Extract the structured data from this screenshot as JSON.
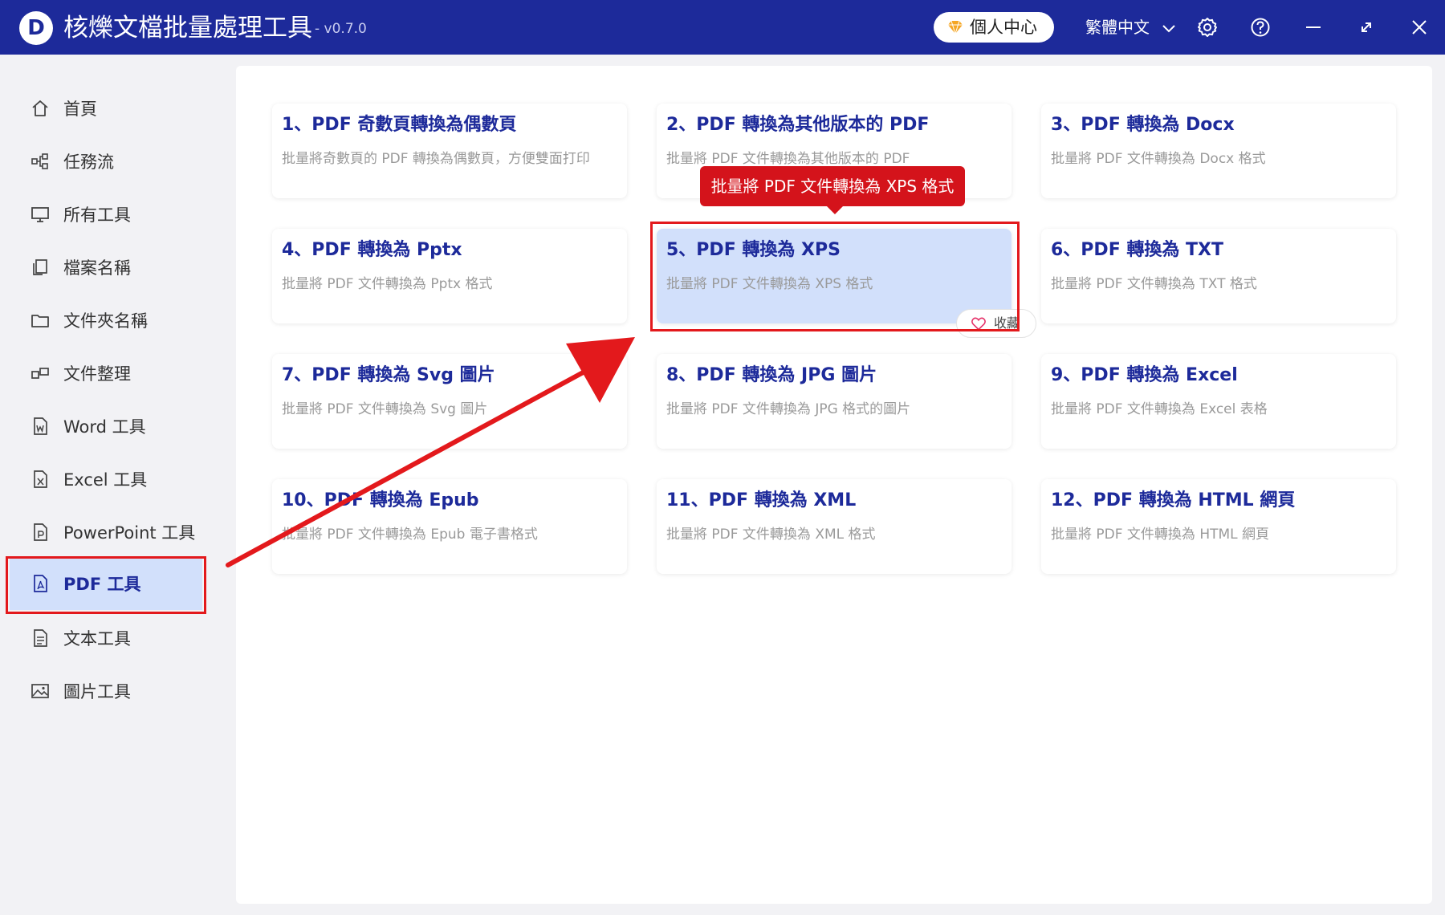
{
  "titlebar": {
    "app_title": "核爍文檔批量處理工具",
    "version": "- v0.7.0",
    "user_center_label": "個人中心",
    "language": "繁體中文",
    "icons": [
      "settings-icon",
      "help-icon",
      "minimize-icon",
      "maximize-icon",
      "close-icon"
    ]
  },
  "sidebar": {
    "items": [
      {
        "label": "首頁",
        "icon": "home-icon"
      },
      {
        "label": "任務流",
        "icon": "workflow-icon"
      },
      {
        "label": "所有工具",
        "icon": "monitor-icon"
      },
      {
        "label": "檔案名稱",
        "icon": "file-copy-icon"
      },
      {
        "label": "文件夾名稱",
        "icon": "folder-icon"
      },
      {
        "label": "文件整理",
        "icon": "organize-icon"
      },
      {
        "label": "Word 工具",
        "icon": "word-doc-icon"
      },
      {
        "label": "Excel 工具",
        "icon": "excel-doc-icon"
      },
      {
        "label": "PowerPoint 工具",
        "icon": "ppt-doc-icon"
      },
      {
        "label": "PDF 工具",
        "icon": "pdf-doc-icon",
        "active": true
      },
      {
        "label": "文本工具",
        "icon": "text-doc-icon"
      },
      {
        "label": "圖片工具",
        "icon": "image-icon"
      }
    ]
  },
  "tools": [
    {
      "title": "1、PDF 奇數頁轉換為偶數頁",
      "desc": "批量將奇數頁的 PDF 轉換為偶數頁，方便雙面打印"
    },
    {
      "title": "2、PDF 轉換為其他版本的 PDF",
      "desc": "批量將 PDF 文件轉換為其他版本的 PDF"
    },
    {
      "title": "3、PDF 轉換為 Docx",
      "desc": "批量將 PDF 文件轉換為 Docx 格式"
    },
    {
      "title": "4、PDF 轉換為 Pptx",
      "desc": "批量將 PDF 文件轉換為 Pptx 格式"
    },
    {
      "title": "5、PDF 轉換為 XPS",
      "desc": "批量將 PDF 文件轉換為 XPS 格式",
      "hovered": true
    },
    {
      "title": "6、PDF 轉換為 TXT",
      "desc": "批量將 PDF 文件轉換為 TXT 格式"
    },
    {
      "title": "7、PDF 轉換為 Svg 圖片",
      "desc": "批量將 PDF 文件轉換為 Svg 圖片"
    },
    {
      "title": "8、PDF 轉換為 JPG 圖片",
      "desc": "批量將 PDF 文件轉換為 JPG 格式的圖片"
    },
    {
      "title": "9、PDF 轉換為 Excel",
      "desc": "批量將 PDF 文件轉換為 Excel 表格"
    },
    {
      "title": "10、PDF 轉換為 Epub",
      "desc": "批量將 PDF 文件轉換為 Epub 電子書格式"
    },
    {
      "title": "11、PDF 轉換為 XML",
      "desc": "批量將 PDF 文件轉換為 XML 格式"
    },
    {
      "title": "12、PDF 轉換為 HTML 網頁",
      "desc": "批量將 PDF 文件轉換為 HTML 網頁"
    }
  ],
  "tooltip": "批量將 PDF 文件轉換為 XPS 格式",
  "favorite_label": "收藏",
  "colors": {
    "titlebar": "#1d2a9a",
    "accent": "#1d2a9a",
    "active_bg": "#d2e0fb",
    "annotation_red": "#e3191c"
  }
}
